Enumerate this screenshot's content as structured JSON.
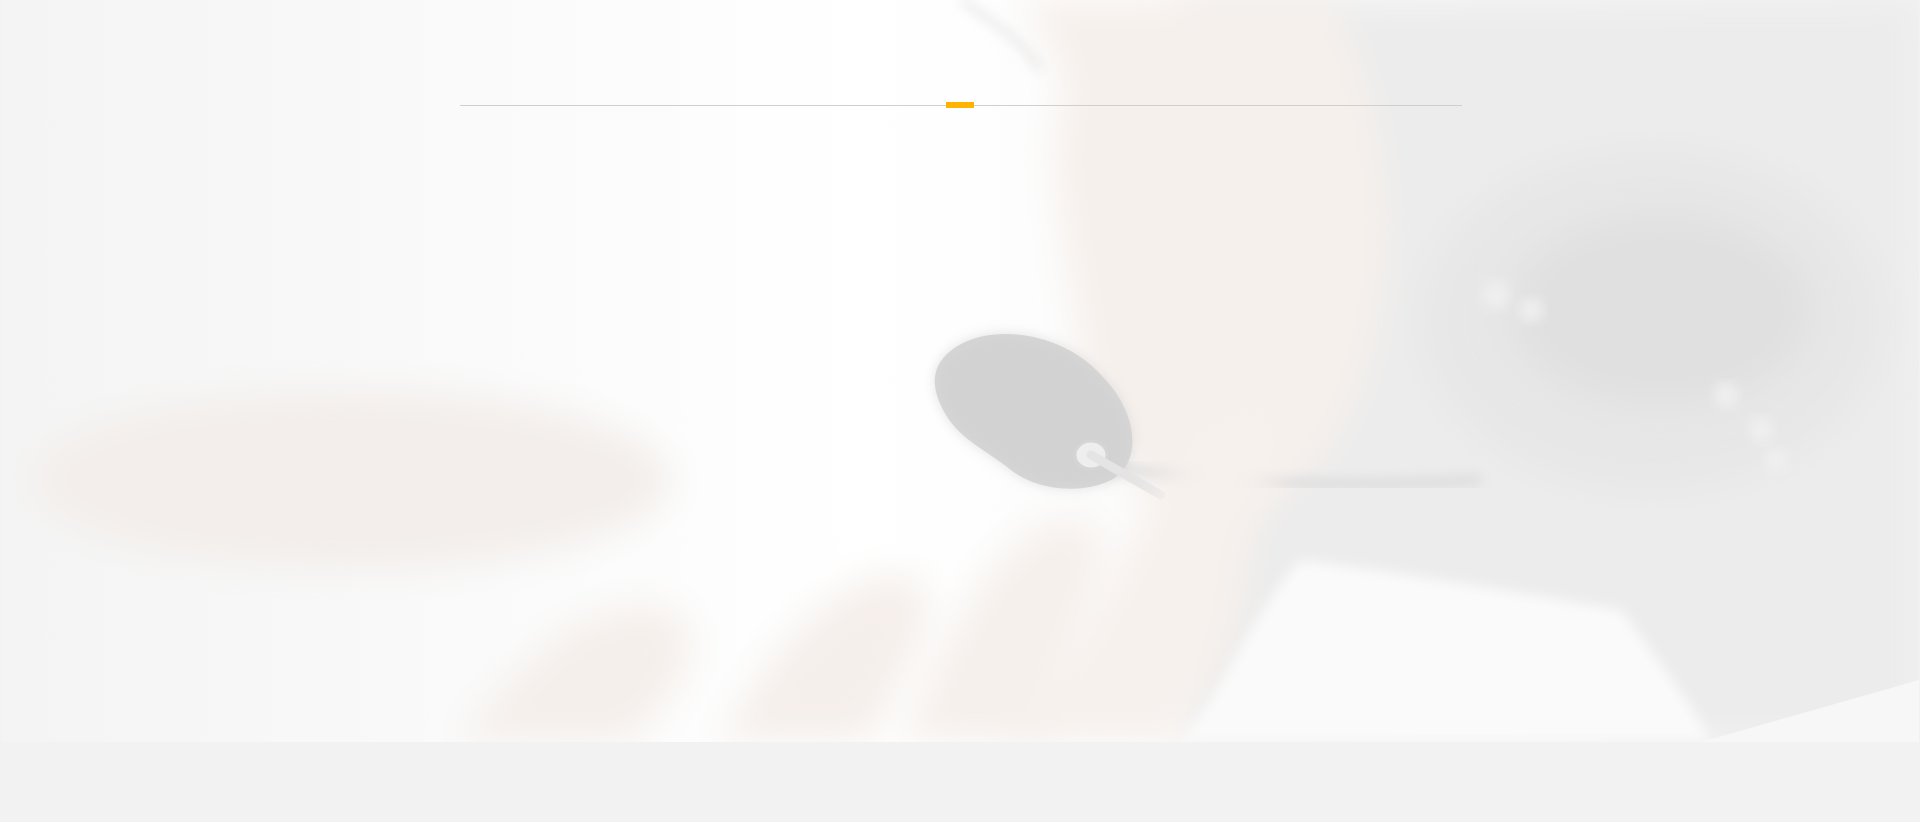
{
  "hero": {
    "image": "faded-photo-person-holding-headset-microphone"
  },
  "section_header": {
    "divider_color": "#cfcfcf",
    "accent_color": "#ffb400"
  },
  "colors": {
    "page_background": "#f2f2f2",
    "hero_background": "#fbfbfb"
  }
}
